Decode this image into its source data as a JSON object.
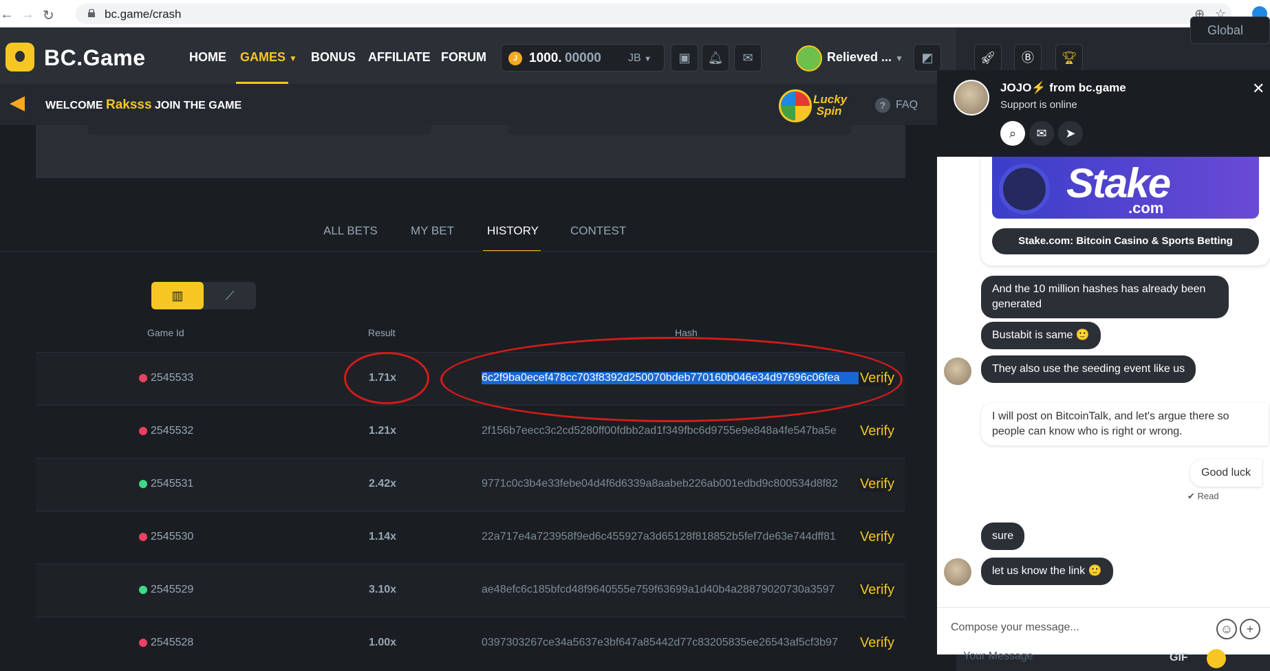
{
  "browser": {
    "url": "bc.game/crash"
  },
  "header": {
    "logo_text": "BC.Game",
    "menu": [
      "HOME",
      "GAMES",
      "BONUS",
      "AFFILIATE",
      "FORUM"
    ],
    "balance_int": "1000.",
    "balance_dec": "00000",
    "currency": "JB",
    "username": "Relieved ..."
  },
  "welcome": {
    "prefix": "WELCOME",
    "name": "Raksss",
    "suffix": "JOIN THE GAME",
    "lucky_line1": "Lucky",
    "lucky_line2": "Spin",
    "faq": "FAQ"
  },
  "tabs": [
    "ALL BETS",
    "MY BET",
    "HISTORY",
    "CONTEST"
  ],
  "table": {
    "headers": [
      "Game Id",
      "Result",
      "Hash"
    ],
    "verify_label": "Verify",
    "rows": [
      {
        "id": "2545533",
        "result": "1.71x",
        "hash": "6c2f9ba0ecef478cc703f8392d250070bdeb770160b046e34d97696c06fea",
        "status": "red"
      },
      {
        "id": "2545532",
        "result": "1.21x",
        "hash": "2f156b7eecc3c2cd5280ff00fdbb2ad1f349fbc6d9755e9e848a4fe547ba5e",
        "status": "red"
      },
      {
        "id": "2545531",
        "result": "2.42x",
        "hash": "9771c0c3b4e33febe04d4f6d6339a8aabeb226ab001edbd9c800534d8f82",
        "status": "green"
      },
      {
        "id": "2545530",
        "result": "1.14x",
        "hash": "22a717e4a723958f9ed6c455927a3d65128f818852b5fef7de63e744dff81",
        "status": "red"
      },
      {
        "id": "2545529",
        "result": "3.10x",
        "hash": "ae48efc6c185bfcd48f9640555e759f63699a1d40b4a28879020730a3597",
        "status": "green"
      },
      {
        "id": "2545528",
        "result": "1.00x",
        "hash": "0397303267ce34a5637e3bf647a85442d77c83205835ee26543af5cf3b97",
        "status": "red"
      }
    ]
  },
  "right": {
    "global_label": "Global"
  },
  "chat": {
    "agent_name": "JOJO⚡ from bc.game",
    "agent_status": "Support is online",
    "promo_logo": "Stake",
    "promo_com": ".com",
    "promo_button": "Stake.com: Bitcoin Casino & Sports Betting",
    "messages": [
      {
        "text": "And the 10 million hashes has already been generated",
        "style": "dark"
      },
      {
        "text": "Bustabit is same 🙂",
        "style": "dark"
      },
      {
        "text": "They also use the seeding event like us",
        "style": "dark"
      },
      {
        "text": "I will post on BitcoinTalk, and let's argue there so people can know who is right or wrong.",
        "style": "light"
      },
      {
        "text": "Good luck",
        "style": "light"
      },
      {
        "text": "sure",
        "style": "dark"
      },
      {
        "text": "let us know the link 🙂",
        "style": "dark"
      }
    ],
    "read_label": "✔ Read",
    "compose_placeholder": "Compose your message...",
    "below_placeholder": "Your Message",
    "gif_label": "GIF"
  },
  "colors": {
    "accent": "#f6c722",
    "win": "#3ddc84",
    "loss": "#ed4163",
    "annotation": "#d51b1b"
  }
}
